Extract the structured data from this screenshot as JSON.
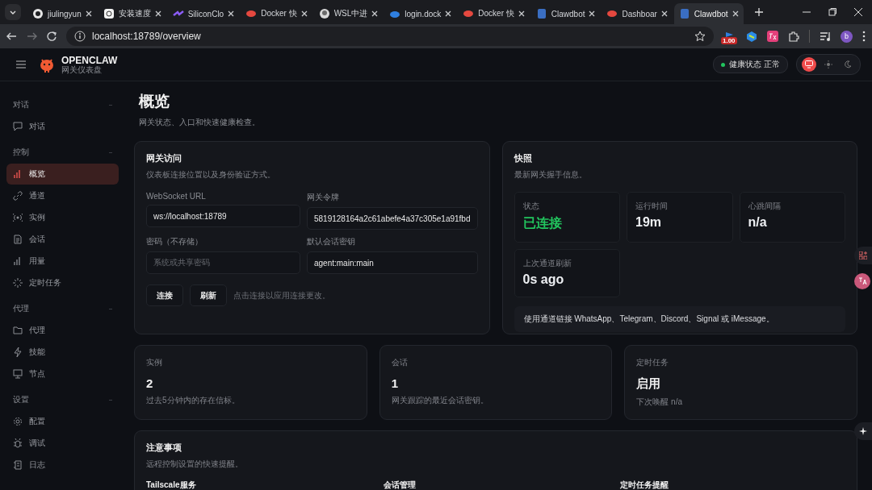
{
  "browser": {
    "tabs": [
      {
        "label": "jiulingyun",
        "selected": false
      },
      {
        "label": "安装速度",
        "selected": false
      },
      {
        "label": "SiliconClo",
        "selected": false
      },
      {
        "label": "Docker 快",
        "selected": false
      },
      {
        "label": "WSL中进",
        "selected": false
      },
      {
        "label": "login.dock",
        "selected": false
      },
      {
        "label": "Docker 快",
        "selected": false
      },
      {
        "label": "Clawdbot",
        "selected": false
      },
      {
        "label": "Dashboar",
        "selected": false
      },
      {
        "label": "Clawdbot",
        "selected": true
      }
    ],
    "url": "localhost:18789/overview",
    "extension_badge": "1.00",
    "profile_initial": "b"
  },
  "app": {
    "brand": "OPENCLAW",
    "brand_subtitle": "网关仪表盘",
    "health": {
      "label": "健康状态",
      "value": "正常",
      "color": "#22c55e"
    },
    "theme_modes": [
      {
        "selected": true
      },
      {
        "selected": false
      },
      {
        "selected": false
      }
    ]
  },
  "sidebar": {
    "groups": [
      {
        "label": "对话",
        "items": [
          {
            "label": "对话",
            "selected": false
          }
        ]
      },
      {
        "label": "控制",
        "items": [
          {
            "label": "概览",
            "selected": true
          },
          {
            "label": "通道",
            "selected": false
          },
          {
            "label": "实例",
            "selected": false
          },
          {
            "label": "会话",
            "selected": false
          },
          {
            "label": "用量",
            "selected": false
          },
          {
            "label": "定时任务",
            "selected": false
          }
        ]
      },
      {
        "label": "代理",
        "items": [
          {
            "label": "代理",
            "selected": false
          },
          {
            "label": "技能",
            "selected": false
          },
          {
            "label": "节点",
            "selected": false
          }
        ]
      },
      {
        "label": "设置",
        "items": [
          {
            "label": "配置",
            "selected": false
          },
          {
            "label": "调试",
            "selected": false
          },
          {
            "label": "日志",
            "selected": false
          }
        ]
      }
    ]
  },
  "page": {
    "title": "概览",
    "subtitle": "网关状态、入口和快速健康检查。"
  },
  "gateway_access": {
    "title": "网关访问",
    "subtitle": "仪表板连接位置以及身份验证方式。",
    "fields": [
      {
        "label": "WebSocket URL",
        "value": "ws://localhost:18789"
      },
      {
        "label": "网关令牌",
        "value": "5819128164a2c61abefe4a37c305e1a91fbd"
      },
      {
        "label": "密码（不存储）",
        "placeholder": "系统或共享密码"
      },
      {
        "label": "默认会话密钥",
        "value": "agent:main:main"
      }
    ],
    "buttons": [
      "连接",
      "刷新"
    ],
    "hint": "点击连接以应用连接更改。"
  },
  "snapshot": {
    "title": "快照",
    "subtitle": "最新网关握手信息。",
    "stats": [
      {
        "label": "状态",
        "value": "已连接",
        "color": "#22c55e"
      },
      {
        "label": "运行时间",
        "value": "19m",
        "color": "#eef0f3"
      },
      {
        "label": "心跳间隔",
        "value": "n/a",
        "color": "#eef0f3"
      },
      {
        "label": "上次通道刷新",
        "value": "0s ago",
        "color": "#eef0f3"
      }
    ],
    "note": "使用通道链接 WhatsApp、Telegram、Discord、Signal 或 iMessage。"
  },
  "summary_cards": [
    {
      "label": "实例",
      "value": "2",
      "detail": "过去5分钟内的存在信标。"
    },
    {
      "label": "会话",
      "value": "1",
      "detail": "网关跟踪的最近会话密钥。"
    },
    {
      "label": "定时任务",
      "value": "启用",
      "detail": "下次唤醒 n/a"
    }
  ],
  "notes": {
    "title": "注意事项",
    "subtitle": "远程控制设置的快速提醒。",
    "items": [
      {
        "title": "Tailscale服务"
      },
      {
        "title": "会话管理"
      },
      {
        "title": "定时任务提醒"
      }
    ]
  }
}
